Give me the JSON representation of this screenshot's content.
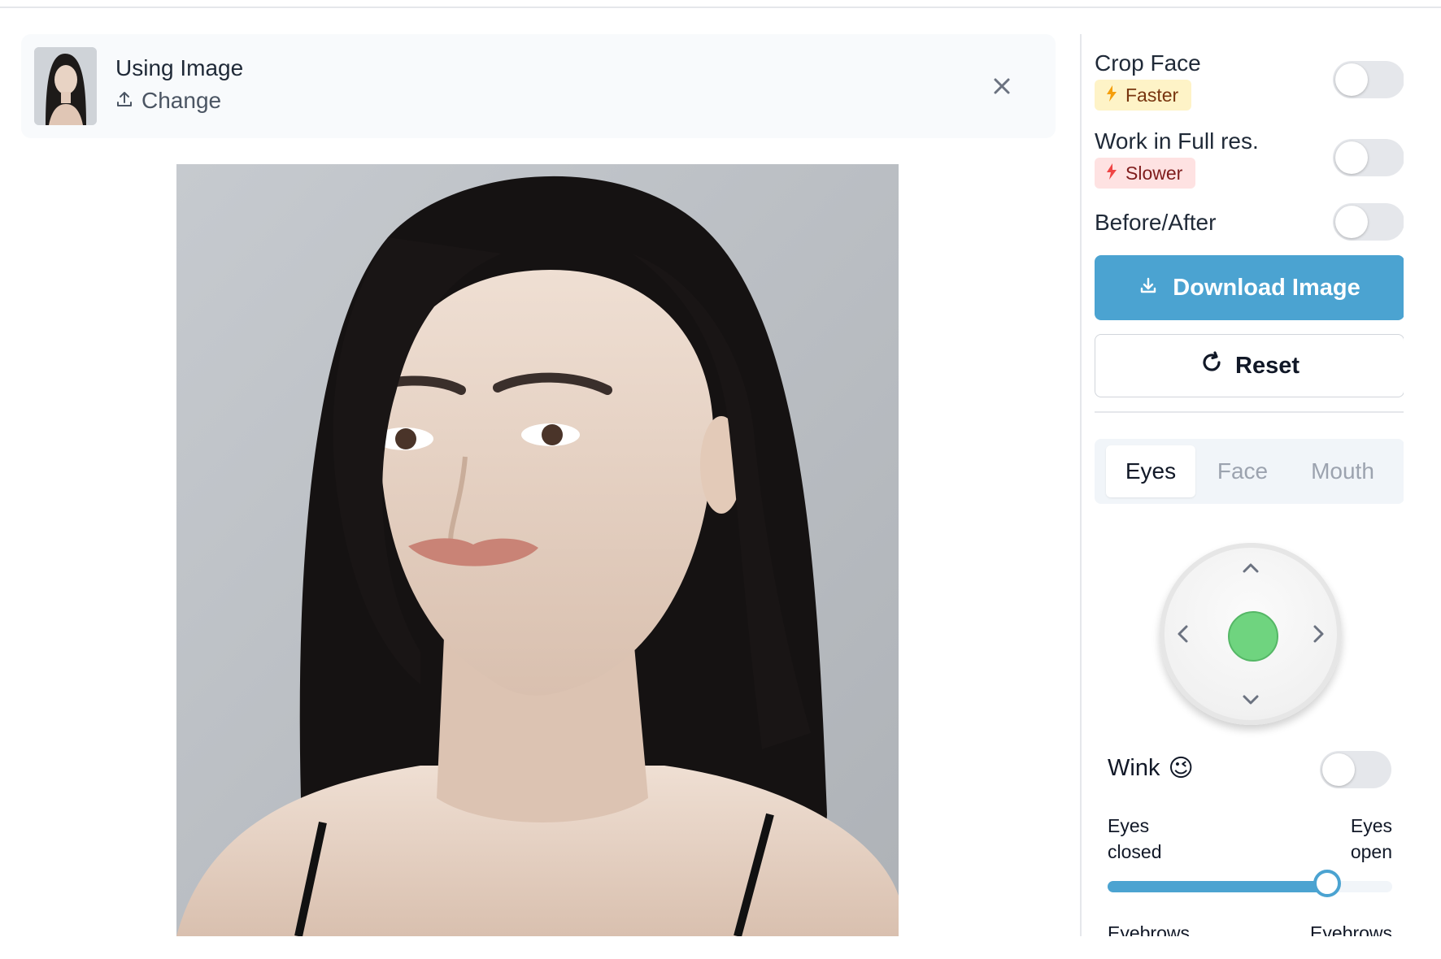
{
  "header": {
    "title": "Using Image",
    "change_label": "Change",
    "close_icon": "close-icon",
    "upload_icon": "upload-icon"
  },
  "options": {
    "crop_face": {
      "label": "Crop Face",
      "badge": "Faster",
      "enabled": false
    },
    "full_res": {
      "label": "Work in Full res.",
      "badge": "Slower",
      "enabled": false
    },
    "before_after": {
      "label": "Before/After",
      "enabled": false
    }
  },
  "actions": {
    "download_label": "Download Image",
    "reset_label": "Reset"
  },
  "tabs": [
    {
      "label": "Eyes",
      "active": true
    },
    {
      "label": "Face",
      "active": false
    },
    {
      "label": "Mouth",
      "active": false
    }
  ],
  "eyes": {
    "wink_label": "Wink",
    "wink_emoji": "😉",
    "wink_enabled": false,
    "slider_left_label": "Eyes closed",
    "slider_right_label": "Eyes open",
    "slider_value": 0.77,
    "next_left_label": "Eyebrows",
    "next_right_label": "Eyebrows"
  },
  "colors": {
    "accent": "#4ba3d1",
    "joystick_dot": "#6fd47f",
    "badge_faster_bg": "#fef3c7",
    "badge_slower_bg": "#fee2e2"
  }
}
